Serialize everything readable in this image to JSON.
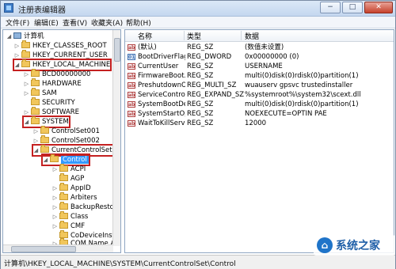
{
  "window": {
    "title": "注册表编辑器",
    "minimize_label": "−",
    "maximize_label": "□",
    "close_label": "✕"
  },
  "menu": [
    "文件(F)",
    "编辑(E)",
    "查看(V)",
    "收藏夹(A)",
    "帮助(H)"
  ],
  "tree": {
    "root": "计算机",
    "nodes": [
      {
        "label": "HKEY_CLASSES_ROOT",
        "expander": "▷"
      },
      {
        "label": "HKEY_CURRENT_USER",
        "expander": "▷"
      },
      {
        "label": "HKEY_LOCAL_MACHINE",
        "expander": "◢",
        "highlighted": true
      },
      {
        "label": "BCD00000000",
        "expander": "▷"
      },
      {
        "label": "HARDWARE",
        "expander": "▷"
      },
      {
        "label": "SAM",
        "expander": "▷"
      },
      {
        "label": "SECURITY",
        "expander": ""
      },
      {
        "label": "SOFTWARE",
        "expander": "▷"
      },
      {
        "label": "SYSTEM",
        "expander": "◢",
        "highlighted": true
      },
      {
        "label": "ControlSet001",
        "expander": "▷"
      },
      {
        "label": "ControlSet002",
        "expander": "▷"
      },
      {
        "label": "CurrentControlSet",
        "expander": "◢",
        "highlighted": true
      },
      {
        "label": "Control",
        "expander": "◢",
        "highlighted": true,
        "selected": true
      },
      {
        "label": "ACPI",
        "expander": "▷"
      },
      {
        "label": "AGP",
        "expander": ""
      },
      {
        "label": "AppID",
        "expander": "▷"
      },
      {
        "label": "Arbiters",
        "expander": "▷"
      },
      {
        "label": "BackupRestore",
        "expander": "▷"
      },
      {
        "label": "Class",
        "expander": "▷"
      },
      {
        "label": "CMF",
        "expander": "▷"
      },
      {
        "label": "CoDeviceInstall",
        "expander": ""
      },
      {
        "label": "COM Name Ar",
        "expander": "▷"
      }
    ]
  },
  "list": {
    "headers": {
      "name": "名称",
      "type": "类型",
      "data": "数据"
    },
    "rows": [
      {
        "icon": "ab",
        "name": "(默认)",
        "type": "REG_SZ",
        "data": "(数值未设置)"
      },
      {
        "icon": "bin",
        "name": "BootDriverFlags",
        "type": "REG_DWORD",
        "data": "0x00000000 (0)"
      },
      {
        "icon": "ab",
        "name": "CurrentUser",
        "type": "REG_SZ",
        "data": "USERNAME"
      },
      {
        "icon": "ab",
        "name": "FirmwareBoot...",
        "type": "REG_SZ",
        "data": "multi(0)disk(0)rdisk(0)partition(1)"
      },
      {
        "icon": "ab",
        "name": "PreshutdownO...",
        "type": "REG_MULTI_SZ",
        "data": "wuauserv gpsvc trustedinstaller"
      },
      {
        "icon": "ab",
        "name": "ServiceControl...",
        "type": "REG_EXPAND_SZ",
        "data": "%systemroot%\\system32\\scext.dll"
      },
      {
        "icon": "ab",
        "name": "SystemBootDe...",
        "type": "REG_SZ",
        "data": "multi(0)disk(0)rdisk(0)partition(1)"
      },
      {
        "icon": "ab",
        "name": "SystemStartOp...",
        "type": "REG_SZ",
        "data": " NOEXECUTE=OPTIN  PAE"
      },
      {
        "icon": "ab",
        "name": "WaitToKillServi...",
        "type": "REG_SZ",
        "data": "12000"
      }
    ]
  },
  "statusbar": {
    "path": "计算机\\HKEY_LOCAL_MACHINE\\SYSTEM\\CurrentControlSet\\Control"
  },
  "watermark": {
    "text": "系统之家"
  },
  "colors": {
    "highlight_box": "#c42020",
    "selection": "#3399ff",
    "folder": "#f1c65b"
  }
}
